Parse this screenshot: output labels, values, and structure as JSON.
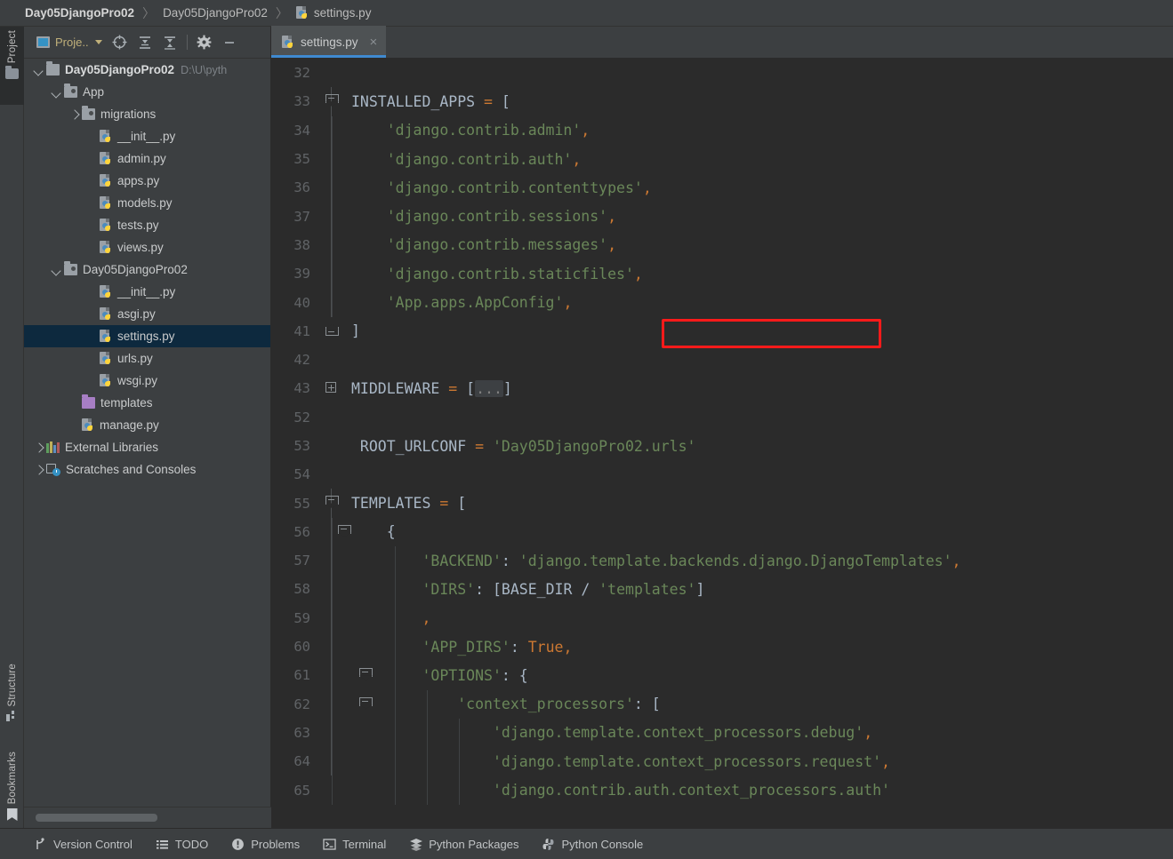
{
  "breadcrumb": {
    "items": [
      {
        "label": "Day05DjangoPro02",
        "bold": true
      },
      {
        "label": "Day05DjangoPro02",
        "bold": false
      },
      {
        "label": "settings.py",
        "icon": "python-file-icon"
      }
    ],
    "separator": "〉"
  },
  "tool_strip": {
    "top": {
      "label": "Project",
      "icon": "folder-icon"
    },
    "structure": {
      "label": "Structure",
      "icon": "structure-icon"
    },
    "bookmarks": {
      "label": "Bookmarks",
      "icon": "bookmark-icon"
    }
  },
  "project_panel": {
    "toolbar": {
      "select_label": "Proje..",
      "buttons": [
        {
          "name": "select-opened-file-icon",
          "glyph": "target"
        },
        {
          "name": "expand-all-icon",
          "glyph": "expand"
        },
        {
          "name": "collapse-all-icon",
          "glyph": "collapse"
        },
        {
          "name": "settings-gear-icon",
          "glyph": "gear"
        },
        {
          "name": "hide-panel-icon",
          "glyph": "minus"
        }
      ]
    },
    "tree": [
      {
        "label": "Day05DjangoPro02",
        "path": "D:\\U\\pyth",
        "icon": "folder-icon",
        "arrow": "down",
        "indent": 0,
        "bold": true,
        "selected": false
      },
      {
        "label": "App",
        "icon": "module-folder-icon",
        "arrow": "down",
        "indent": 1,
        "bold": false,
        "selected": false
      },
      {
        "label": "migrations",
        "icon": "module-folder-icon",
        "arrow": "right",
        "indent": 2,
        "bold": false,
        "selected": false
      },
      {
        "label": "__init__.py",
        "icon": "python-file-icon",
        "arrow": "none",
        "indent": 3,
        "bold": false,
        "selected": false
      },
      {
        "label": "admin.py",
        "icon": "python-file-icon",
        "arrow": "none",
        "indent": 3,
        "bold": false,
        "selected": false
      },
      {
        "label": "apps.py",
        "icon": "python-file-icon",
        "arrow": "none",
        "indent": 3,
        "bold": false,
        "selected": false
      },
      {
        "label": "models.py",
        "icon": "python-file-icon",
        "arrow": "none",
        "indent": 3,
        "bold": false,
        "selected": false
      },
      {
        "label": "tests.py",
        "icon": "python-file-icon",
        "arrow": "none",
        "indent": 3,
        "bold": false,
        "selected": false
      },
      {
        "label": "views.py",
        "icon": "python-file-icon",
        "arrow": "none",
        "indent": 3,
        "bold": false,
        "selected": false
      },
      {
        "label": "Day05DjangoPro02",
        "icon": "module-folder-icon",
        "arrow": "down",
        "indent": 1,
        "bold": false,
        "selected": false
      },
      {
        "label": "__init__.py",
        "icon": "python-file-icon",
        "arrow": "none",
        "indent": 3,
        "bold": false,
        "selected": false
      },
      {
        "label": "asgi.py",
        "icon": "python-file-icon",
        "arrow": "none",
        "indent": 3,
        "bold": false,
        "selected": false
      },
      {
        "label": "settings.py",
        "icon": "python-file-icon",
        "arrow": "none",
        "indent": 3,
        "bold": false,
        "selected": true
      },
      {
        "label": "urls.py",
        "icon": "python-file-icon",
        "arrow": "none",
        "indent": 3,
        "bold": false,
        "selected": false
      },
      {
        "label": "wsgi.py",
        "icon": "python-file-icon",
        "arrow": "none",
        "indent": 3,
        "bold": false,
        "selected": false
      },
      {
        "label": "templates",
        "icon": "templates-folder-icon",
        "arrow": "none",
        "indent": 2,
        "bold": false,
        "selected": false
      },
      {
        "label": "manage.py",
        "icon": "python-file-icon",
        "arrow": "none",
        "indent": 2,
        "bold": false,
        "selected": false
      },
      {
        "label": "External Libraries",
        "icon": "library-icon",
        "arrow": "right",
        "indent": 0,
        "bold": false,
        "selected": false
      },
      {
        "label": "Scratches and Consoles",
        "icon": "scratches-icon",
        "arrow": "right",
        "indent": 0,
        "bold": false,
        "selected": false
      }
    ]
  },
  "editor": {
    "tab": {
      "label": "settings.py",
      "icon": "python-file-icon",
      "close": "×",
      "active": true
    },
    "lines": [
      {
        "num": "32",
        "fold": "",
        "indent_guides": [],
        "tokens": []
      },
      {
        "num": "33",
        "fold": "open",
        "indent_guides": [],
        "tokens": [
          {
            "t": "INSTALLED_APPS ",
            "c": "k-var"
          },
          {
            "t": "= ",
            "c": "punct"
          },
          {
            "t": "[",
            "c": "k-var"
          }
        ]
      },
      {
        "num": "34",
        "fold": "",
        "indent_guides": [
          20
        ],
        "tokens": [
          {
            "t": "    ",
            "c": "k-var"
          },
          {
            "t": "'django.contrib.admin'",
            "c": "k-str"
          },
          {
            "t": ",",
            "c": "punct"
          }
        ]
      },
      {
        "num": "35",
        "fold": "",
        "indent_guides": [
          20
        ],
        "tokens": [
          {
            "t": "    ",
            "c": "k-var"
          },
          {
            "t": "'django.contrib.auth'",
            "c": "k-str"
          },
          {
            "t": ",",
            "c": "punct"
          }
        ]
      },
      {
        "num": "36",
        "fold": "",
        "indent_guides": [
          20
        ],
        "tokens": [
          {
            "t": "    ",
            "c": "k-var"
          },
          {
            "t": "'django.contrib.contenttypes'",
            "c": "k-str"
          },
          {
            "t": ",",
            "c": "punct"
          }
        ]
      },
      {
        "num": "37",
        "fold": "",
        "indent_guides": [
          20
        ],
        "tokens": [
          {
            "t": "    ",
            "c": "k-var"
          },
          {
            "t": "'django.contrib.sessions'",
            "c": "k-str"
          },
          {
            "t": ",",
            "c": "punct"
          }
        ]
      },
      {
        "num": "38",
        "fold": "",
        "indent_guides": [
          20
        ],
        "tokens": [
          {
            "t": "    ",
            "c": "k-var"
          },
          {
            "t": "'django.contrib.messages'",
            "c": "k-str"
          },
          {
            "t": ",",
            "c": "punct"
          }
        ]
      },
      {
        "num": "39",
        "fold": "",
        "indent_guides": [
          20
        ],
        "tokens": [
          {
            "t": "    ",
            "c": "k-var"
          },
          {
            "t": "'django.contrib.staticfiles'",
            "c": "k-str"
          },
          {
            "t": ",",
            "c": "punct"
          }
        ]
      },
      {
        "num": "40",
        "fold": "",
        "indent_guides": [
          20
        ],
        "tokens": [
          {
            "t": "    ",
            "c": "k-var"
          },
          {
            "t": "'App.apps.AppConfig'",
            "c": "k-str"
          },
          {
            "t": ",",
            "c": "punct"
          }
        ]
      },
      {
        "num": "41",
        "fold": "end",
        "indent_guides": [],
        "tokens": [
          {
            "t": "]",
            "c": "k-var"
          }
        ]
      },
      {
        "num": "42",
        "fold": "",
        "indent_guides": [],
        "tokens": []
      },
      {
        "num": "43",
        "fold": "plus",
        "indent_guides": [],
        "tokens": [
          {
            "t": "MIDDLEWARE ",
            "c": "k-var"
          },
          {
            "t": "= ",
            "c": "punct"
          },
          {
            "t": "[",
            "c": "k-var"
          },
          {
            "t": "...",
            "c": "collapsed-box"
          },
          {
            "t": "]",
            "c": "k-var"
          }
        ]
      },
      {
        "num": "52",
        "fold": "",
        "indent_guides": [],
        "tokens": []
      },
      {
        "num": "53",
        "fold": "",
        "indent_guides": [],
        "tokens": [
          {
            "t": " ROOT_URLCONF ",
            "c": "k-var"
          },
          {
            "t": "= ",
            "c": "punct"
          },
          {
            "t": "'Day05DjangoPro02.urls'",
            "c": "k-str"
          }
        ]
      },
      {
        "num": "54",
        "fold": "",
        "indent_guides": [],
        "tokens": []
      },
      {
        "num": "55",
        "fold": "open",
        "indent_guides": [],
        "tokens": [
          {
            "t": "TEMPLATES ",
            "c": "k-var"
          },
          {
            "t": "= ",
            "c": "punct"
          },
          {
            "t": "[",
            "c": "k-var"
          }
        ]
      },
      {
        "num": "56",
        "fold": "open-sub",
        "indent_guides": [
          20
        ],
        "tokens": [
          {
            "t": "    {",
            "c": "k-var"
          }
        ]
      },
      {
        "num": "57",
        "fold": "",
        "indent_guides": [
          20,
          91
        ],
        "tokens": [
          {
            "t": "        ",
            "c": "k-var"
          },
          {
            "t": "'BACKEND'",
            "c": "k-str"
          },
          {
            "t": ": ",
            "c": "k-var"
          },
          {
            "t": "'django.template.backends.django.DjangoTemplates'",
            "c": "k-str"
          },
          {
            "t": ",",
            "c": "punct"
          }
        ]
      },
      {
        "num": "58",
        "fold": "",
        "indent_guides": [
          20,
          91
        ],
        "tokens": [
          {
            "t": "        ",
            "c": "k-var"
          },
          {
            "t": "'DIRS'",
            "c": "k-str"
          },
          {
            "t": ": [",
            "c": "k-var"
          },
          {
            "t": "BASE_DIR",
            "c": "k-var"
          },
          {
            "t": " / ",
            "c": "k-var"
          },
          {
            "t": "'templates'",
            "c": "k-str"
          },
          {
            "t": "]",
            "c": "k-var"
          }
        ]
      },
      {
        "num": "59",
        "fold": "",
        "indent_guides": [
          20,
          91
        ],
        "tokens": [
          {
            "t": "        ",
            "c": "k-var"
          },
          {
            "t": ",",
            "c": "punct"
          }
        ]
      },
      {
        "num": "60",
        "fold": "",
        "indent_guides": [
          20,
          91
        ],
        "tokens": [
          {
            "t": "        ",
            "c": "k-var"
          },
          {
            "t": "'APP_DIRS'",
            "c": "k-str"
          },
          {
            "t": ": ",
            "c": "k-var"
          },
          {
            "t": "True",
            "c": "k-kw"
          },
          {
            "t": ",",
            "c": "punct"
          }
        ]
      },
      {
        "num": "61",
        "fold": "open-sub2",
        "indent_guides": [
          20,
          91
        ],
        "tokens": [
          {
            "t": "        ",
            "c": "k-var"
          },
          {
            "t": "'OPTIONS'",
            "c": "k-str"
          },
          {
            "t": ": {",
            "c": "k-var"
          }
        ]
      },
      {
        "num": "62",
        "fold": "open-sub2",
        "indent_guides": [
          20,
          91,
          127
        ],
        "tokens": [
          {
            "t": "            ",
            "c": "k-var"
          },
          {
            "t": "'context_processors'",
            "c": "k-str"
          },
          {
            "t": ": [",
            "c": "k-var"
          }
        ]
      },
      {
        "num": "63",
        "fold": "",
        "indent_guides": [
          20,
          91,
          127,
          163
        ],
        "tokens": [
          {
            "t": "                ",
            "c": "k-var"
          },
          {
            "t": "'django.template.context_processors.debug'",
            "c": "k-str"
          },
          {
            "t": ",",
            "c": "punct"
          }
        ]
      },
      {
        "num": "64",
        "fold": "",
        "indent_guides": [
          20,
          91,
          127,
          163
        ],
        "tokens": [
          {
            "t": "                ",
            "c": "k-var"
          },
          {
            "t": "'django.template.context_processors.request'",
            "c": "k-str"
          },
          {
            "t": ",",
            "c": "punct"
          }
        ]
      },
      {
        "num": "65",
        "fold": "",
        "indent_guides": [
          20,
          91,
          127,
          163
        ],
        "tokens": [
          {
            "t": "                ",
            "c": "k-var"
          },
          {
            "t": "'django.contrib.auth.context_processors.auth'",
            "c": "k-str"
          }
        ]
      }
    ],
    "annotation": {
      "name": "red-highlight-box",
      "target_line": "40",
      "color": "#ff1a1a"
    },
    "mouse_cursor": "i-beam-cursor"
  },
  "statusbar": {
    "items": [
      {
        "label": "Version Control",
        "icon": "branch-icon"
      },
      {
        "label": "TODO",
        "icon": "todo-list-icon"
      },
      {
        "label": "Problems",
        "icon": "problems-icon"
      },
      {
        "label": "Terminal",
        "icon": "terminal-icon"
      },
      {
        "label": "Python Packages",
        "icon": "packages-icon"
      },
      {
        "label": "Python Console",
        "icon": "python-console-icon"
      }
    ]
  },
  "colors": {
    "panel_bg": "#3c3f41",
    "editor_bg": "#2b2b2b",
    "selection": "#0d293e",
    "tab_accent": "#3f8ad0",
    "string": "#6a8759",
    "keyword": "#cc7832",
    "annotation": "#ff1a1a"
  }
}
